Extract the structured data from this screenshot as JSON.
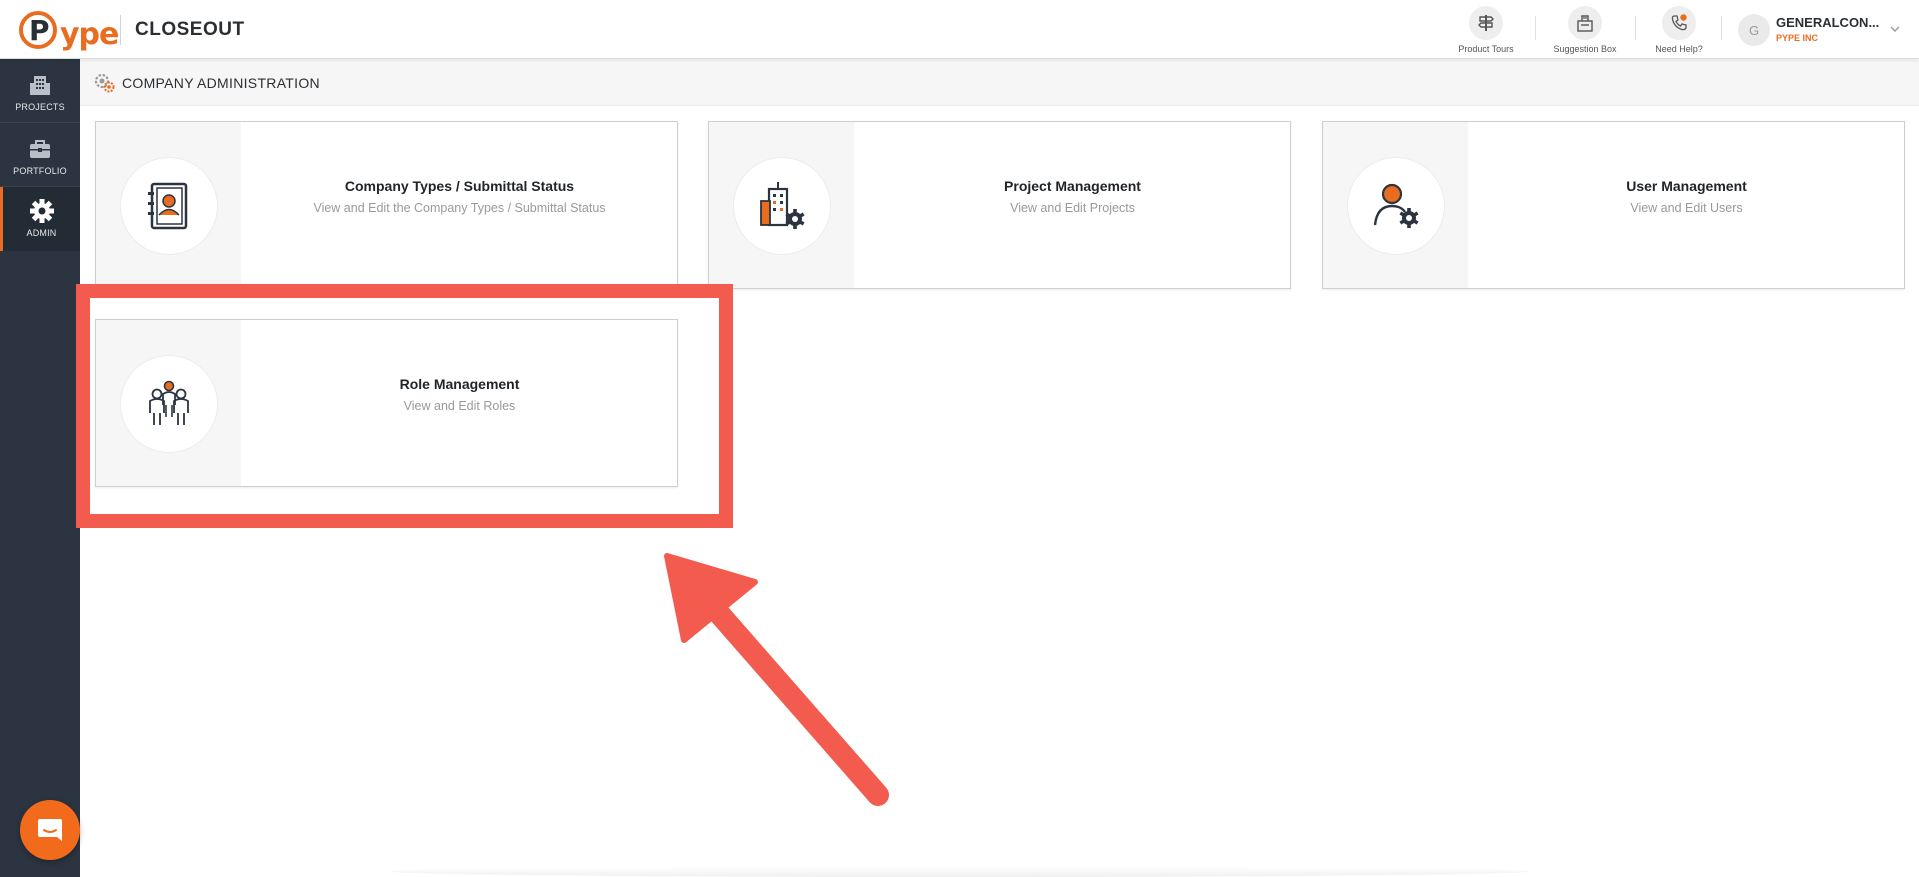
{
  "app": {
    "logo_text": "ype",
    "title": "CLOSEOUT"
  },
  "header": {
    "tools": [
      {
        "label": "Product Tours",
        "icon": "signpost-icon"
      },
      {
        "label": "Suggestion Box",
        "icon": "suggestion-box-icon"
      },
      {
        "label": "Need Help?",
        "icon": "phone-help-icon"
      }
    ],
    "user": {
      "initial": "G",
      "name": "GENERALCON...",
      "org": "PYPE INC"
    }
  },
  "sidebar": {
    "items": [
      {
        "label": "PROJECTS",
        "icon": "building-icon"
      },
      {
        "label": "PORTFOLIO",
        "icon": "briefcase-icon"
      },
      {
        "label": "ADMIN",
        "icon": "gear-icon",
        "active": true
      }
    ]
  },
  "page": {
    "title": "COMPANY ADMINISTRATION",
    "icon": "gears-icon"
  },
  "cards": [
    {
      "title": "Company Types / Submittal Status",
      "desc": "View and Edit the Company Types / Submittal Status",
      "icon": "address-book-icon"
    },
    {
      "title": "Project Management",
      "desc": "View and Edit Projects",
      "icon": "building-gear-icon"
    },
    {
      "title": "User Management",
      "desc": "View and Edit Users",
      "icon": "user-gear-icon"
    },
    {
      "title": "Role Management",
      "desc": "View and Edit Roles",
      "icon": "group-icon"
    }
  ],
  "colors": {
    "brand_orange": "#e86d20",
    "sidebar_bg": "#2b3440",
    "annotation_red": "#f25b4e",
    "chat_orange": "#f26b1d"
  }
}
